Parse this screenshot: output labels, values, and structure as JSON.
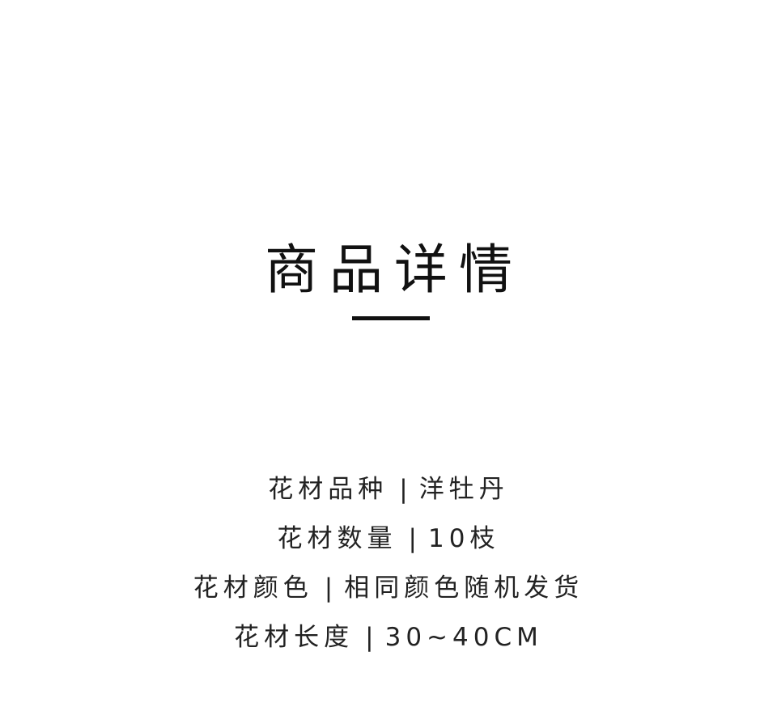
{
  "title": "商品详情",
  "separator": "|",
  "specs": [
    {
      "label": "花材品种",
      "value": "洋牡丹"
    },
    {
      "label": "花材数量",
      "value": "10枝"
    },
    {
      "label": "花材颜色",
      "value": "相同颜色随机发货"
    },
    {
      "label": "花材长度",
      "value": "30~40CM"
    }
  ]
}
